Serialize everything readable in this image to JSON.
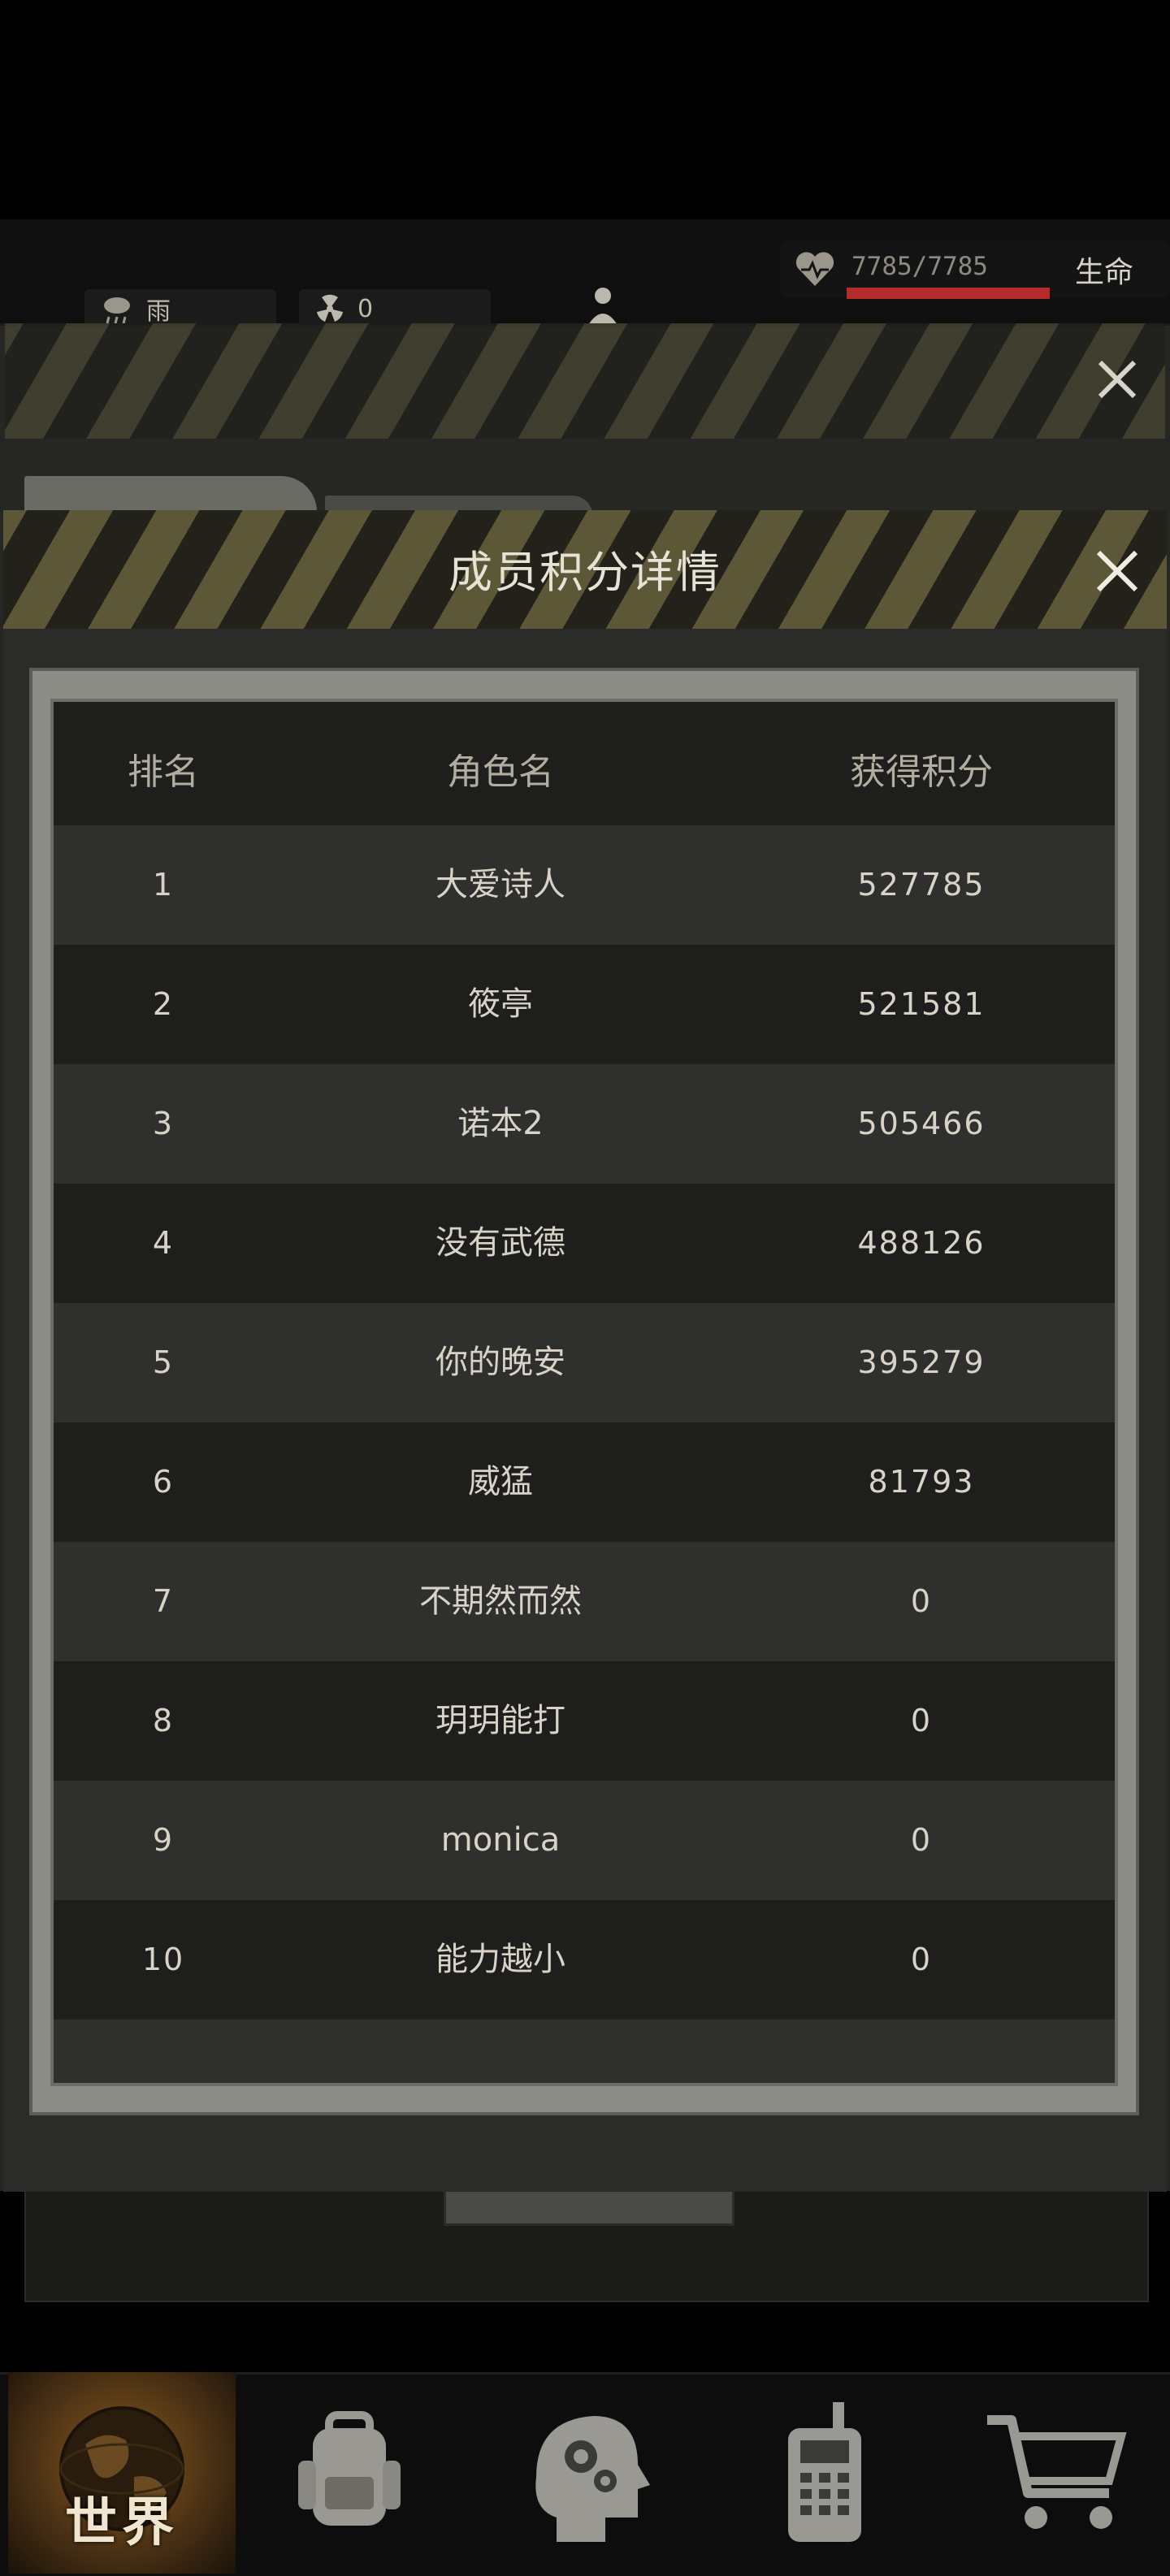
{
  "status": {
    "weather_label": "雨",
    "radiation_value": "0",
    "life_value": "7785/7785",
    "life_label": "生命",
    "life_fraction": 1.0
  },
  "dialog": {
    "title": "成员积分详情",
    "columns": [
      "排名",
      "角色名",
      "获得积分"
    ],
    "rows": [
      {
        "rank": "1",
        "name": "大爱诗人",
        "score": "527785"
      },
      {
        "rank": "2",
        "name": "筱亭",
        "score": "521581"
      },
      {
        "rank": "3",
        "name": "诺本2",
        "score": "505466"
      },
      {
        "rank": "4",
        "name": "没有武德",
        "score": "488126"
      },
      {
        "rank": "5",
        "name": "你的晚安",
        "score": "395279"
      },
      {
        "rank": "6",
        "name": "威猛",
        "score": "81793"
      },
      {
        "rank": "7",
        "name": "不期然而然",
        "score": "0"
      },
      {
        "rank": "8",
        "name": "玥玥能打",
        "score": "0"
      },
      {
        "rank": "9",
        "name": "monica",
        "score": "0"
      },
      {
        "rank": "10",
        "name": "能力越小",
        "score": "0"
      }
    ]
  },
  "nav": {
    "items": [
      {
        "label": "世界",
        "icon": "globe-icon",
        "active": true
      },
      {
        "label": "",
        "icon": "backpack-icon",
        "active": false
      },
      {
        "label": "",
        "icon": "head-gears-icon",
        "active": false
      },
      {
        "label": "",
        "icon": "radio-phone-icon",
        "active": false
      },
      {
        "label": "",
        "icon": "cart-icon",
        "active": false
      }
    ]
  },
  "colors": {
    "life_bar": "#b52a2a",
    "accent_orange": "#8a5a1e",
    "hazard_yellow": "#786f40"
  }
}
